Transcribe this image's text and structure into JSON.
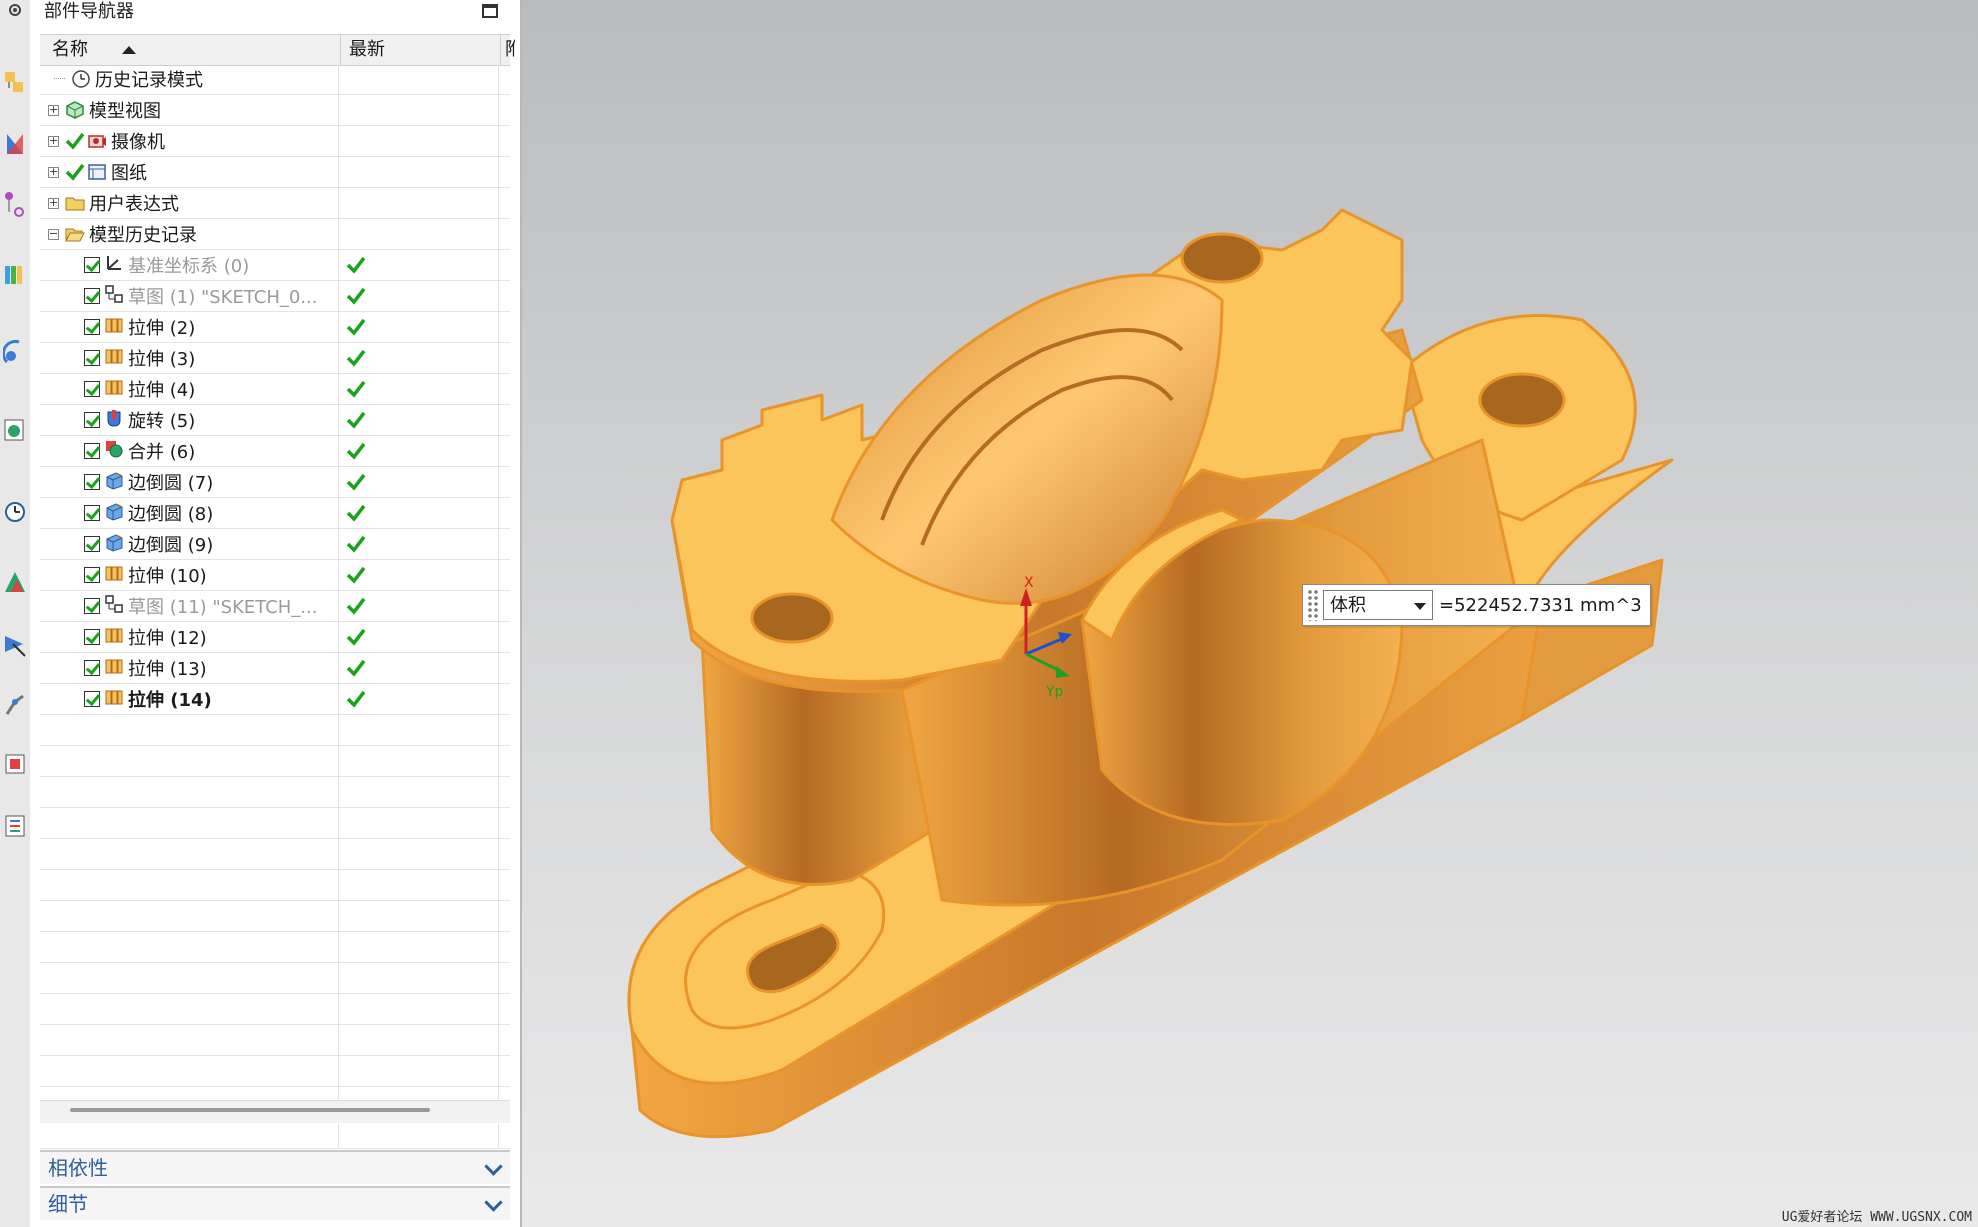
{
  "navigator": {
    "title": "部件导航器",
    "columns": {
      "name": "名称",
      "latest": "最新",
      "dependency": "附"
    }
  },
  "tree": {
    "history_mode": "历史记录模式",
    "model_views": "模型视图",
    "cameras": "摄像机",
    "drawings": "图纸",
    "user_expressions": "用户表达式",
    "model_history": "模型历史记录"
  },
  "features": [
    {
      "label": "基准坐标系 (0)",
      "icon": "datum-csys-icon",
      "dim": true,
      "bold": false
    },
    {
      "label": "草图 (1) \"SKETCH_0...",
      "icon": "sketch-icon",
      "dim": true,
      "bold": false
    },
    {
      "label": "拉伸 (2)",
      "icon": "extrude-icon",
      "dim": false,
      "bold": false
    },
    {
      "label": "拉伸 (3)",
      "icon": "extrude-icon",
      "dim": false,
      "bold": false
    },
    {
      "label": "拉伸 (4)",
      "icon": "extrude-icon",
      "dim": false,
      "bold": false
    },
    {
      "label": "旋转 (5)",
      "icon": "revolve-icon",
      "dim": false,
      "bold": false
    },
    {
      "label": "合并 (6)",
      "icon": "unite-icon",
      "dim": false,
      "bold": false
    },
    {
      "label": "边倒圆 (7)",
      "icon": "edge-blend-icon",
      "dim": false,
      "bold": false
    },
    {
      "label": "边倒圆 (8)",
      "icon": "edge-blend-icon",
      "dim": false,
      "bold": false
    },
    {
      "label": "边倒圆 (9)",
      "icon": "edge-blend-icon",
      "dim": false,
      "bold": false
    },
    {
      "label": "拉伸 (10)",
      "icon": "extrude-icon",
      "dim": false,
      "bold": false
    },
    {
      "label": "草图 (11) \"SKETCH_...",
      "icon": "sketch-icon",
      "dim": true,
      "bold": false
    },
    {
      "label": "拉伸 (12)",
      "icon": "extrude-icon",
      "dim": false,
      "bold": false
    },
    {
      "label": "拉伸 (13)",
      "icon": "extrude-icon",
      "dim": false,
      "bold": false
    },
    {
      "label": "拉伸 (14)",
      "icon": "extrude-icon",
      "dim": false,
      "bold": true
    }
  ],
  "panels": {
    "dependencies": "相依性",
    "details": "细节"
  },
  "measure": {
    "type_selected": "体积",
    "result": "=522452.7331 mm^3"
  },
  "triad": {
    "x_label": "X",
    "y_label": "Yp"
  },
  "watermark": "UG爱好者论坛 WWW.UGSNX.COM",
  "colors": {
    "model": "#f9b84a",
    "model_edge": "#e89a2c",
    "check": "#1aa31a",
    "link": "#2d5f9a"
  }
}
